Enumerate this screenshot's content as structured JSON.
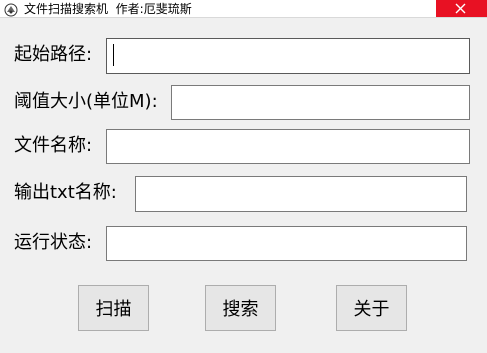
{
  "window": {
    "title": "文件扫描搜索机",
    "author": "作者:厄斐琉斯",
    "app_icon": "app-logo-icon",
    "close_icon": "close-icon"
  },
  "form": {
    "start_path": {
      "label": "起始路径:",
      "value": ""
    },
    "threshold": {
      "label": "阈值大小(单位M):",
      "value": ""
    },
    "file_name": {
      "label": "文件名称:",
      "value": ""
    },
    "output_txt": {
      "label": "输出txt名称:",
      "value": ""
    },
    "status": {
      "label": "运行状态:",
      "value": ""
    }
  },
  "buttons": {
    "scan": "扫描",
    "search": "搜索",
    "about": "关于"
  }
}
